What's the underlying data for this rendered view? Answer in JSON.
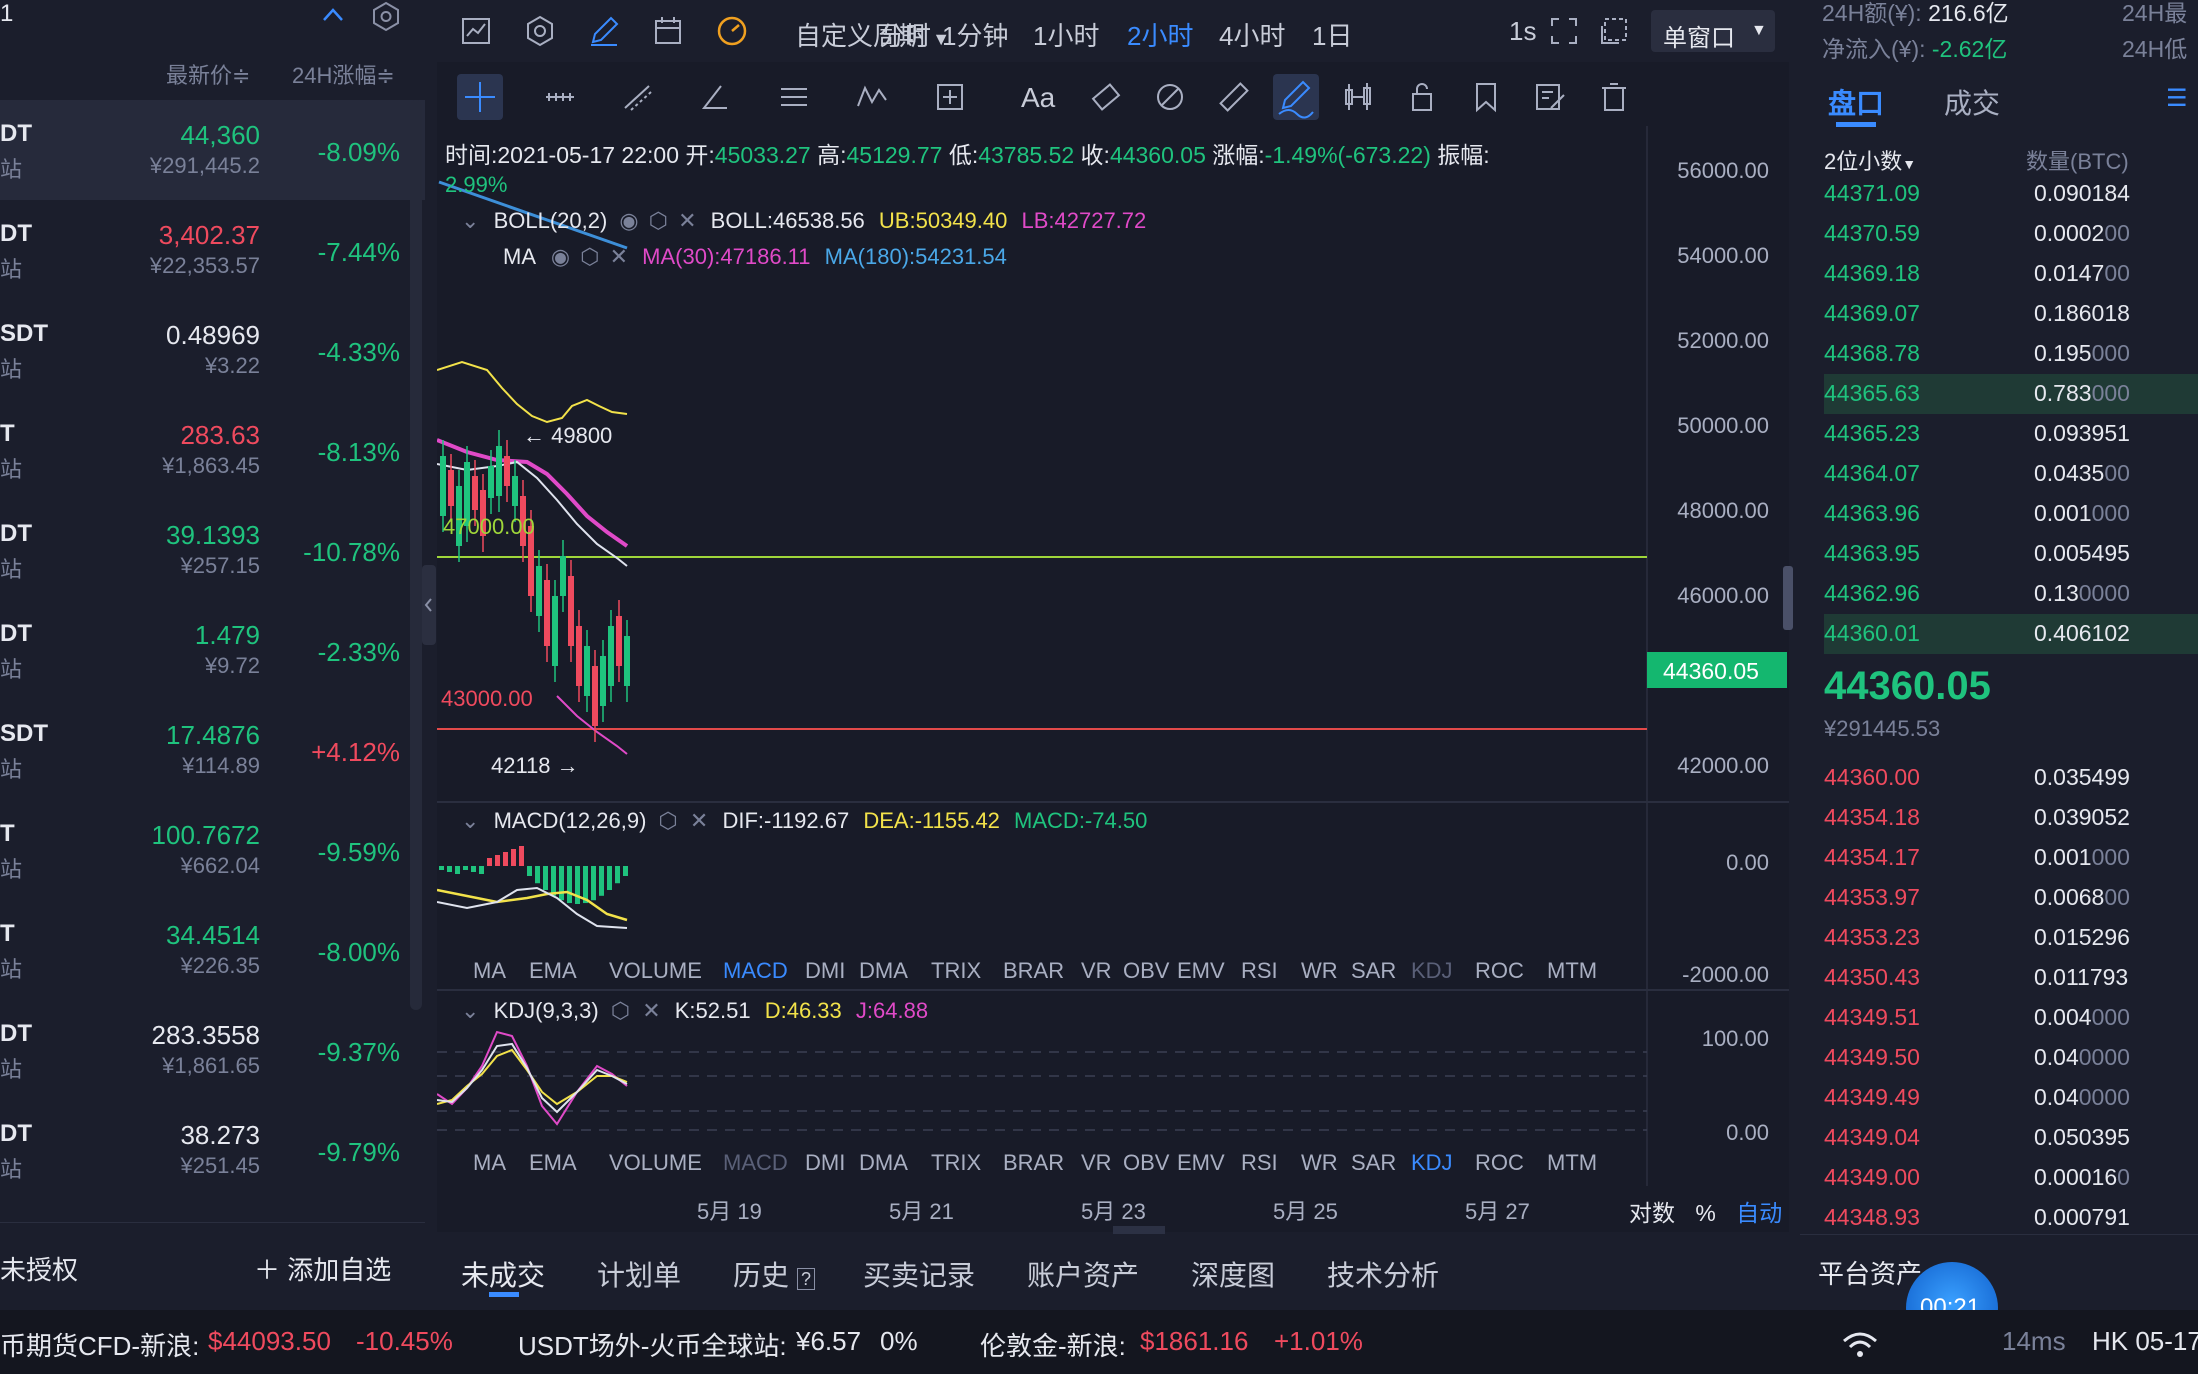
{
  "left_panel": {
    "top_left_num": "1",
    "col_price": "最新价≑",
    "col_change": "24H涨幅≑",
    "rows": [
      {
        "sym": "DT",
        "sub": "站",
        "price": "44,360",
        "cny": "¥291,445.2",
        "chg": "-8.09%"
      },
      {
        "sym": "DT",
        "sub": "站",
        "price": "3,402.37",
        "cny": "¥22,353.57",
        "chg": "-7.44%"
      },
      {
        "sym": "SDT",
        "sub": "站",
        "price": "0.48969",
        "cny": "¥3.22",
        "chg": "-4.33%"
      },
      {
        "sym": "T",
        "sub": "站",
        "price": "283.63",
        "cny": "¥1,863.45",
        "chg": "-8.13%"
      },
      {
        "sym": "DT",
        "sub": "站",
        "price": "39.1393",
        "cny": "¥257.15",
        "chg": "-10.78%"
      },
      {
        "sym": "DT",
        "sub": "站",
        "price": "1.479",
        "cny": "¥9.72",
        "chg": "-2.33%"
      },
      {
        "sym": "SDT",
        "sub": "站",
        "price": "17.4876",
        "cny": "¥114.89",
        "chg": "+4.12%"
      },
      {
        "sym": "T",
        "sub": "站",
        "price": "100.7672",
        "cny": "¥662.04",
        "chg": "-9.59%"
      },
      {
        "sym": "T",
        "sub": "站",
        "price": "34.4514",
        "cny": "¥226.35",
        "chg": "-8.00%"
      },
      {
        "sym": "DT",
        "sub": "站",
        "price": "283.3558",
        "cny": "¥1,861.65",
        "chg": "-9.37%"
      },
      {
        "sym": "DT",
        "sub": "站",
        "price": "38.273",
        "cny": "¥251.45",
        "chg": "-9.79%"
      }
    ],
    "unauth": "未授权",
    "add_fav": "＋ 添加自选"
  },
  "toolbar": {
    "period_custom": "自定义周期",
    "periods": [
      "分时",
      "1分钟",
      "1小时",
      "2小时",
      "4小时",
      "1日"
    ],
    "active_period": "2小时",
    "refresh": "1s",
    "window_mode": "单窗口",
    "text_tool": "Aa"
  },
  "ohlc": {
    "time_label": "时间:",
    "time": "2021-05-17 22:00",
    "open_label": "开:",
    "open": "45033.27",
    "high_label": "高:",
    "high": "45129.77",
    "low_label": "低:",
    "low": "43785.52",
    "close_label": "收:",
    "close": "44360.05",
    "chg_label": "涨幅:",
    "chg": "-1.49%(-673.22)",
    "amp_label": "振幅:",
    "pct_small": "2.99%"
  },
  "boll": {
    "name": "BOLL(20,2)",
    "mid": "BOLL:46538.56",
    "ub": "UB:50349.40",
    "lb": "LB:42727.72"
  },
  "ma": {
    "name": "MA",
    "ma30": "MA(30):47186.11",
    "ma180": "MA(180):54231.54"
  },
  "price_axis": [
    "56000.00",
    "54000.00",
    "52000.00",
    "50000.00",
    "48000.00",
    "46000.00",
    "44000.00",
    "42000.00"
  ],
  "current_price_tag": "44360.05",
  "annotations": {
    "high": "← 49800",
    "low": "42118 →",
    "line_green": "47000.00",
    "line_red": "43000.00"
  },
  "macd": {
    "name": "MACD(12,26,9)",
    "dif": "DIF:-1192.67",
    "dea": "DEA:-1155.42",
    "macd": "MACD:-74.50",
    "axis": [
      "0.00",
      "-2000.00"
    ]
  },
  "kdj": {
    "name": "KDJ(9,3,3)",
    "k": "K:52.51",
    "d": "D:46.33",
    "j": "J:64.88",
    "axis": [
      "100.00",
      "0.00"
    ]
  },
  "indicator_tabs": [
    "MA",
    "EMA",
    "VOLUME",
    "MACD",
    "DMI",
    "DMA",
    "TRIX",
    "BRAR",
    "VR",
    "OBV",
    "EMV",
    "RSI",
    "WR",
    "SAR",
    "KDJ",
    "ROC",
    "MTM"
  ],
  "dates": [
    "5月 19",
    "5月 21",
    "5月 23",
    "5月 25",
    "5月 27"
  ],
  "axis_opts": {
    "log": "对数",
    "pct": "%",
    "auto": "自动"
  },
  "bottom_tabs": [
    "未成交",
    "计划单",
    "历史",
    "买卖记录",
    "账户资产",
    "深度图",
    "技术分析"
  ],
  "right_panel": {
    "vol24_label": "24H额(¥):",
    "vol24": "216.6亿",
    "net_label": "净流入(¥):",
    "net": "-2.62亿",
    "h24_a": "24H最",
    "h24_b": "24H低",
    "tab_book": "盘口",
    "tab_trades": "成交",
    "decimals": "2位小数",
    "qty_head": "数量(BTC)",
    "asks": [
      {
        "p": "44371.09",
        "q": "0.090184",
        "d": ""
      },
      {
        "p": "44370.59",
        "q": "0.0002",
        "d": "00"
      },
      {
        "p": "44369.18",
        "q": "0.0147",
        "d": "00"
      },
      {
        "p": "44369.07",
        "q": "0.186018",
        "d": ""
      },
      {
        "p": "44368.78",
        "q": "0.195",
        "d": "000"
      },
      {
        "p": "44365.63",
        "q": "0.783",
        "d": "000"
      },
      {
        "p": "44365.23",
        "q": "0.093951",
        "d": ""
      },
      {
        "p": "44364.07",
        "q": "0.0435",
        "d": "00"
      },
      {
        "p": "44363.96",
        "q": "0.001",
        "d": "000"
      },
      {
        "p": "44363.95",
        "q": "0.005495",
        "d": ""
      },
      {
        "p": "44362.96",
        "q": "0.13",
        "d": "0000"
      },
      {
        "p": "44360.01",
        "q": "0.406102",
        "d": ""
      }
    ],
    "last_price": "44360.05",
    "last_cny": "¥291445.53",
    "bids": [
      {
        "p": "44360.00",
        "q": "0.035499",
        "d": ""
      },
      {
        "p": "44354.18",
        "q": "0.039052",
        "d": ""
      },
      {
        "p": "44354.17",
        "q": "0.001",
        "d": "000"
      },
      {
        "p": "44353.97",
        "q": "0.0068",
        "d": "00"
      },
      {
        "p": "44353.23",
        "q": "0.015296",
        "d": ""
      },
      {
        "p": "44350.43",
        "q": "0.011793",
        "d": ""
      },
      {
        "p": "44349.51",
        "q": "0.004",
        "d": "000"
      },
      {
        "p": "44349.50",
        "q": "0.04",
        "d": "0000"
      },
      {
        "p": "44349.49",
        "q": "0.04",
        "d": "0000"
      },
      {
        "p": "44349.04",
        "q": "0.050395",
        "d": ""
      },
      {
        "p": "44349.00",
        "q": "0.00016",
        "d": "0"
      },
      {
        "p": "44348.93",
        "q": "0.000791",
        "d": ""
      }
    ],
    "platform_assets": "平台资产",
    "timer": "00:21",
    "latency": "14ms",
    "hk": "HK 05-17"
  },
  "ticker": {
    "a_label": "币期货CFD-新浪:",
    "a_price": "$44093.50",
    "a_chg": "-10.45%",
    "b_label": "USDT场外-火币全球站:",
    "b_price": "¥6.57",
    "b_chg": "0%",
    "c_label": "伦敦金-新浪:",
    "c_price": "$1861.16",
    "c_chg": "+1.01%"
  }
}
